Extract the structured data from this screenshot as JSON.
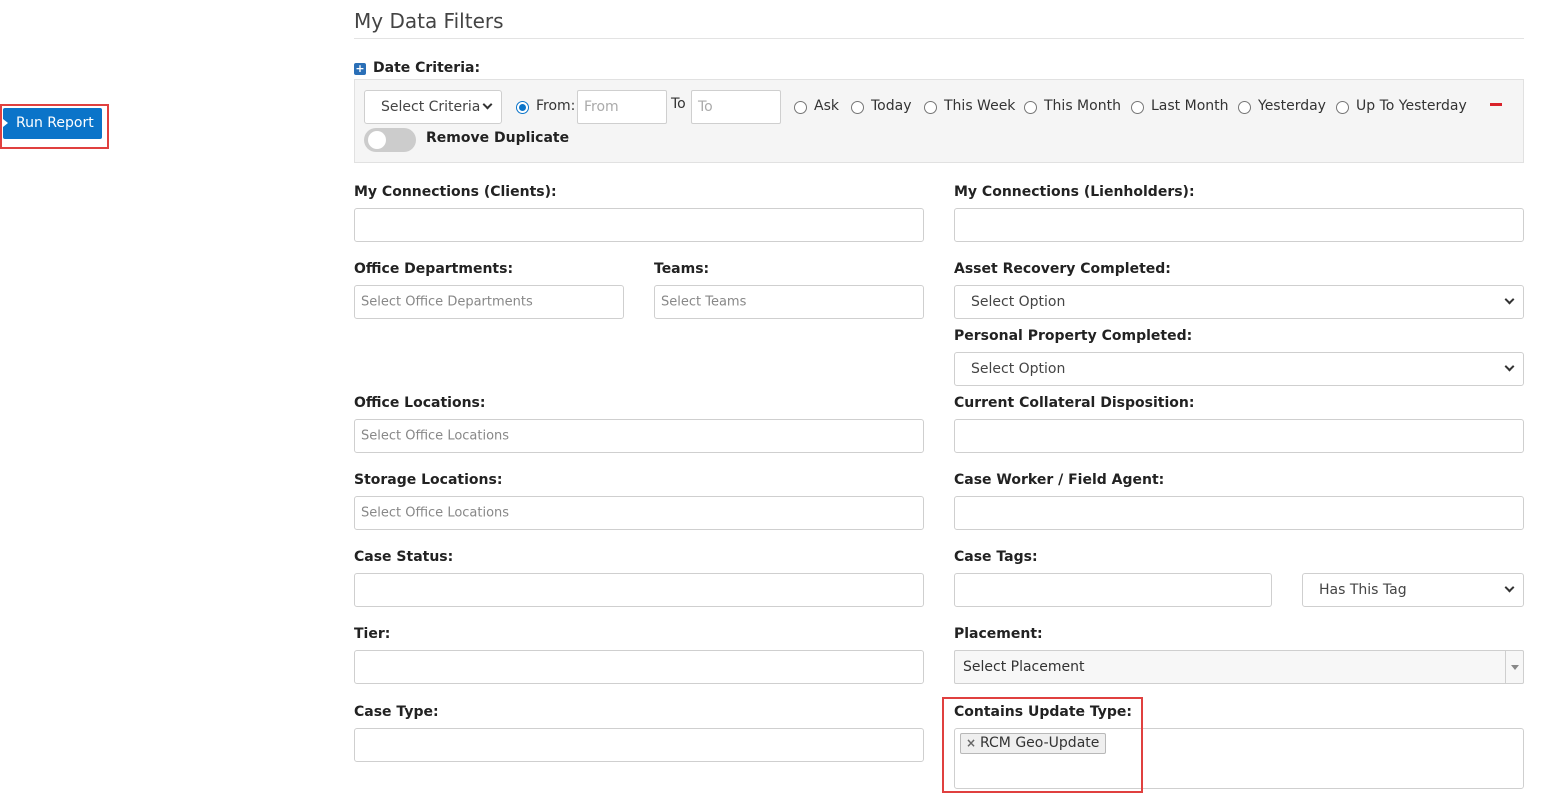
{
  "run_report": {
    "label": "Run Report"
  },
  "page_title": "My Data Filters",
  "date_criteria": {
    "label": "Date Criteria:",
    "plus_icon": "plus-square-icon",
    "minus_icon": "minus-icon",
    "criteria_select": "Select Criteria",
    "from_label": "From:",
    "from_placeholder": "From",
    "to_label": "To",
    "to_placeholder": "To",
    "options": [
      "Ask",
      "Today",
      "This Week",
      "This Month",
      "Last Month",
      "Yesterday",
      "Up To Yesterday"
    ],
    "remove_duplicate_label": "Remove Duplicate",
    "remove_duplicate_on": false
  },
  "fields": {
    "connections_clients": {
      "label": "My Connections (Clients):"
    },
    "connections_lienholders": {
      "label": "My Connections (Lienholders):"
    },
    "office_departments": {
      "label": "Office Departments:",
      "placeholder": "Select Office Departments"
    },
    "teams": {
      "label": "Teams:",
      "placeholder": "Select Teams"
    },
    "asset_recovery": {
      "label": "Asset Recovery Completed:",
      "value": "Select Option"
    },
    "personal_property": {
      "label": "Personal Property Completed:",
      "value": "Select Option"
    },
    "office_locations": {
      "label": "Office Locations:",
      "placeholder": "Select Office Locations"
    },
    "collateral_disposition": {
      "label": "Current Collateral Disposition:"
    },
    "storage_locations": {
      "label": "Storage Locations:",
      "placeholder": "Select Office Locations"
    },
    "case_worker": {
      "label": "Case Worker / Field Agent:"
    },
    "case_status": {
      "label": "Case Status:"
    },
    "case_tags": {
      "label": "Case Tags:",
      "mode": "Has This Tag"
    },
    "tier": {
      "label": "Tier:"
    },
    "placement": {
      "label": "Placement:",
      "value": "Select Placement"
    },
    "case_type": {
      "label": "Case Type:"
    },
    "update_type": {
      "label": "Contains Update Type:",
      "tags": [
        "RCM Geo-Update"
      ]
    }
  },
  "colors": {
    "accent": "#0b74c9",
    "highlight": "#e0403f",
    "danger": "#d9222a"
  }
}
